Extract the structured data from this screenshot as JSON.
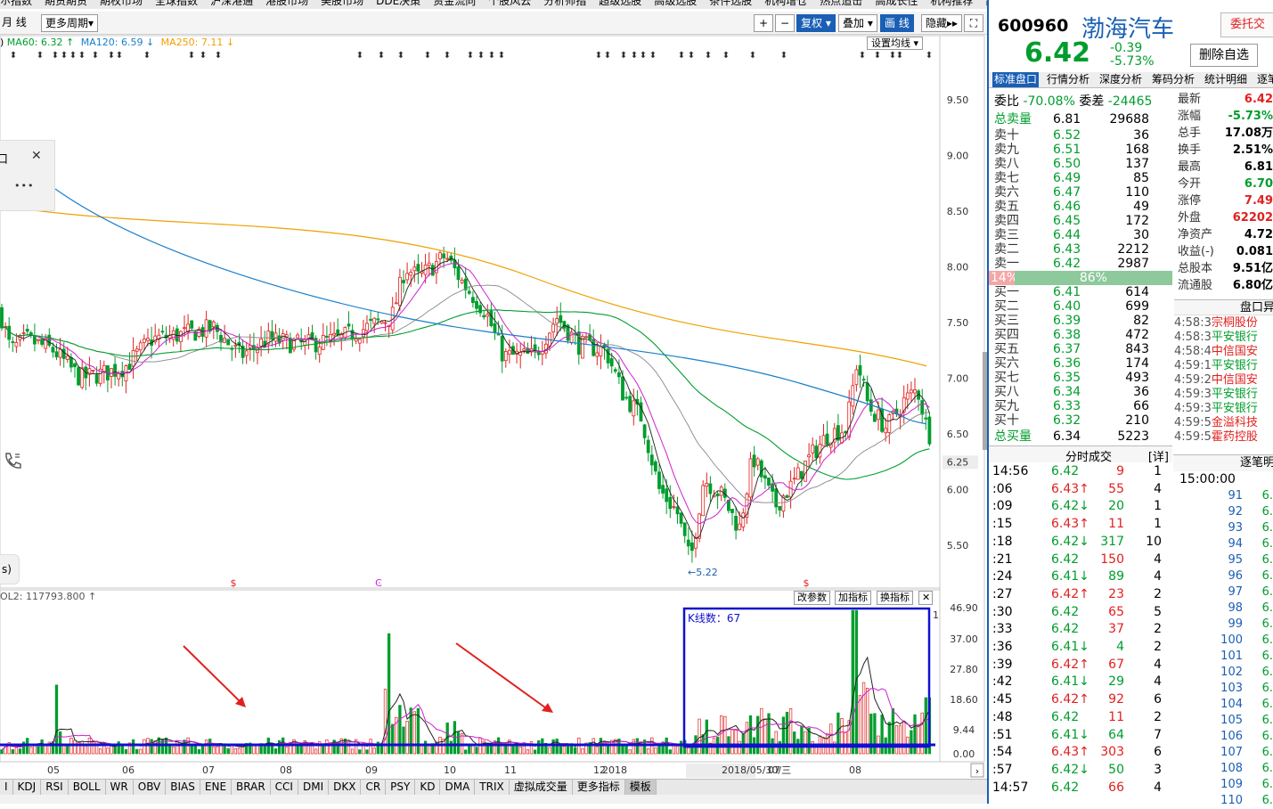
{
  "top_menu": [
    "ホ指数",
    "期货期货",
    "期权市场",
    "全球指数",
    "沪深港通",
    "港股市场",
    "美股市场",
    "DDE决策",
    "资金流向",
    "个股风云",
    "分析师指",
    "超级选股",
    "高级选股",
    "条件选股",
    "机构增仓",
    "热点追击",
    "高成长性",
    "机构推荐",
    "高管增持"
  ],
  "toolbar": {
    "period_partial": "月 线",
    "more_periods": "更多周期",
    "plus": "+",
    "minus": "−",
    "restore": "复权",
    "overlay": "叠加",
    "draw": "画 线",
    "hide": "隐藏",
    "fullscreen": "⛶"
  },
  "ma": {
    "ma60": "MA60: 6.32",
    "ma120": "MA120: 6.59",
    "ma250": "MA250: 7.11",
    "ma60_color": "#009d2d",
    "ma120_color": "#1a7fc9",
    "ma250_color": "#f0a000",
    "prefix": ")"
  },
  "set_ma": "设置均线 ▾",
  "float_panel": {
    "close": "✕",
    "more": "•••",
    "left_char": "口"
  },
  "edge_btn": "s)",
  "price_axis": [
    "9.50",
    "9.00",
    "8.50",
    "8.00",
    "7.50",
    "7.00",
    "6.50",
    "6.25",
    "6.00",
    "5.50"
  ],
  "vol_axis": [
    "46.90",
    "37.00",
    "27.80",
    "18.60",
    "9.44",
    "0.00"
  ],
  "low_price_label": "←5.22",
  "marker_s1": "$",
  "marker_c": "Ͼ",
  "marker_s2": "$",
  "x_labels": [
    "05",
    "06",
    "07",
    "08",
    "09",
    "10",
    "11",
    "12",
    "2018",
    "2018/05/30/三",
    "07",
    "08"
  ],
  "vol_label": "OL2: 117793.800 ↑",
  "vol_buttons": {
    "change": "改参数",
    "add": "加指标",
    "swap": "换指标",
    "close": "✕"
  },
  "kline_box": "K线数：67",
  "vol_edge": "1",
  "bottom_tabs": [
    "I",
    "KDJ",
    "RSI",
    "BOLL",
    "WR",
    "OBV",
    "BIAS",
    "ENE",
    "BRAR",
    "CCI",
    "DMI",
    "DKX",
    "CR",
    "PSY",
    "KD",
    "DMA",
    "TRIX",
    "虚拟成交量",
    "更多指标",
    "模板"
  ],
  "stock": {
    "code": "600960",
    "name": "渤海汽车",
    "price": "6.42",
    "change": "-0.39",
    "pct": "-5.73%",
    "btn_delete": "删除自选",
    "btn_order": "委托交"
  },
  "tabs": [
    "标准盘口",
    "行情分析",
    "深度分析",
    "筹码分析",
    "统计明细",
    "逐笔"
  ],
  "weibi": {
    "label": "委比",
    "value": "-70.08%",
    "diff_label": "委差",
    "diff": "-24465"
  },
  "sell_total": {
    "label": "总卖量",
    "price": "6.81",
    "vol": "29688"
  },
  "sells": [
    {
      "l": "卖十",
      "p": "6.52",
      "v": "36"
    },
    {
      "l": "卖九",
      "p": "6.51",
      "v": "168"
    },
    {
      "l": "卖八",
      "p": "6.50",
      "v": "137"
    },
    {
      "l": "卖七",
      "p": "6.49",
      "v": "85"
    },
    {
      "l": "卖六",
      "p": "6.47",
      "v": "110"
    },
    {
      "l": "卖五",
      "p": "6.46",
      "v": "49"
    },
    {
      "l": "卖四",
      "p": "6.45",
      "v": "172"
    },
    {
      "l": "卖三",
      "p": "6.44",
      "v": "30"
    },
    {
      "l": "卖二",
      "p": "6.43",
      "v": "2212"
    },
    {
      "l": "卖一",
      "p": "6.42",
      "v": "2987"
    }
  ],
  "ratio": {
    "buy": "14%",
    "sell": "86%",
    "buy_frac": 0.14
  },
  "buys": [
    {
      "l": "买一",
      "p": "6.41",
      "v": "614"
    },
    {
      "l": "买二",
      "p": "6.40",
      "v": "699"
    },
    {
      "l": "买三",
      "p": "6.39",
      "v": "82"
    },
    {
      "l": "买四",
      "p": "6.38",
      "v": "472"
    },
    {
      "l": "买五",
      "p": "6.37",
      "v": "843"
    },
    {
      "l": "买六",
      "p": "6.36",
      "v": "174"
    },
    {
      "l": "买七",
      "p": "6.35",
      "v": "493"
    },
    {
      "l": "买八",
      "p": "6.34",
      "v": "36"
    },
    {
      "l": "买九",
      "p": "6.33",
      "v": "66"
    },
    {
      "l": "买十",
      "p": "6.32",
      "v": "210"
    }
  ],
  "buy_total": {
    "label": "总买量",
    "price": "6.34",
    "vol": "5223"
  },
  "stats": [
    {
      "l": "最新",
      "v": "6.42",
      "c": "red"
    },
    {
      "l": "涨幅",
      "v": "-5.73%",
      "c": "grn"
    },
    {
      "l": "总手",
      "v": "17.08万",
      "c": ""
    },
    {
      "l": "换手",
      "v": "2.51%",
      "c": ""
    },
    {
      "l": "最高",
      "v": "6.81",
      "c": ""
    },
    {
      "l": "今开",
      "v": "6.70",
      "c": "grn"
    },
    {
      "l": "涨停",
      "v": "7.49",
      "c": "red"
    },
    {
      "l": "外盘",
      "v": "62202",
      "c": "red"
    },
    {
      "l": "净资产",
      "v": "4.72",
      "c": ""
    },
    {
      "l": "收益(-)",
      "v": "0.081",
      "c": ""
    },
    {
      "l": "总股本",
      "v": "9.51亿",
      "c": ""
    },
    {
      "l": "流通股",
      "v": "6.80亿",
      "c": ""
    }
  ],
  "pankou_title": "盘口异",
  "pankou": [
    {
      "t": "4:58:3",
      "s": "宗桐股份",
      "c": "red"
    },
    {
      "t": "4:58:3",
      "s": "平安银行",
      "c": "grn"
    },
    {
      "t": "4:58:4",
      "s": "中信国安",
      "c": "red"
    },
    {
      "t": "4:59:1",
      "s": "平安银行",
      "c": "grn"
    },
    {
      "t": "4:59:2",
      "s": "中信国安",
      "c": "red"
    },
    {
      "t": "4:59:3",
      "s": "平安银行",
      "c": "grn"
    },
    {
      "t": "4:59:3",
      "s": "平安银行",
      "c": "grn"
    },
    {
      "t": "4:59:5",
      "s": "金溢科技",
      "c": "red"
    },
    {
      "t": "4:59:5",
      "s": "霍药控股",
      "c": "red"
    }
  ],
  "ticks_title": "分时成交",
  "ticks_detail": "[详]",
  "ticks": [
    {
      "t": "14:56",
      "p": "6.42",
      "a": "",
      "v": "9",
      "n": "1"
    },
    {
      "t": ":06",
      "p": "6.43",
      "a": "↑",
      "v": "55",
      "n": "4"
    },
    {
      "t": ":09",
      "p": "6.42",
      "a": "↓",
      "v": "20",
      "n": "1"
    },
    {
      "t": ":15",
      "p": "6.43",
      "a": "↑",
      "v": "11",
      "n": "1"
    },
    {
      "t": ":18",
      "p": "6.42",
      "a": "↓",
      "v": "317",
      "n": "10"
    },
    {
      "t": ":21",
      "p": "6.42",
      "a": "",
      "v": "150",
      "n": "4"
    },
    {
      "t": ":24",
      "p": "6.41",
      "a": "↓",
      "v": "89",
      "n": "4"
    },
    {
      "t": ":27",
      "p": "6.42",
      "a": "↑",
      "v": "23",
      "n": "2"
    },
    {
      "t": ":30",
      "p": "6.42",
      "a": "",
      "v": "65",
      "n": "5"
    },
    {
      "t": ":33",
      "p": "6.42",
      "a": "",
      "v": "37",
      "n": "2"
    },
    {
      "t": ":36",
      "p": "6.41",
      "a": "↓",
      "v": "4",
      "n": "2"
    },
    {
      "t": ":39",
      "p": "6.42",
      "a": "↑",
      "v": "67",
      "n": "4"
    },
    {
      "t": ":42",
      "p": "6.41",
      "a": "↓",
      "v": "29",
      "n": "4"
    },
    {
      "t": ":45",
      "p": "6.42",
      "a": "↑",
      "v": "92",
      "n": "6"
    },
    {
      "t": ":48",
      "p": "6.42",
      "a": "",
      "v": "11",
      "n": "2"
    },
    {
      "t": ":51",
      "p": "6.41",
      "a": "↓",
      "v": "64",
      "n": "7"
    },
    {
      "t": ":54",
      "p": "6.43",
      "a": "↑",
      "v": "303",
      "n": "6"
    },
    {
      "t": ":57",
      "p": "6.42",
      "a": "↓",
      "v": "50",
      "n": "3"
    },
    {
      "t": "14:57",
      "p": "6.42",
      "a": "",
      "v": "66",
      "n": "4"
    }
  ],
  "zhubi_title": "逐笔明",
  "zhubi_time": "15:00:00",
  "zhubi": [
    {
      "n": "91",
      "v": "6."
    },
    {
      "n": "92",
      "v": "6."
    },
    {
      "n": "93",
      "v": "6."
    },
    {
      "n": "94",
      "v": "6."
    },
    {
      "n": "95",
      "v": "6."
    },
    {
      "n": "96",
      "v": "6."
    },
    {
      "n": "97",
      "v": "6."
    },
    {
      "n": "98",
      "v": "6."
    },
    {
      "n": "99",
      "v": "6."
    },
    {
      "n": "100",
      "v": "6."
    },
    {
      "n": "101",
      "v": "6."
    },
    {
      "n": "102",
      "v": "6."
    },
    {
      "n": "103",
      "v": "6."
    },
    {
      "n": "104",
      "v": "6."
    },
    {
      "n": "105",
      "v": "6."
    },
    {
      "n": "106",
      "v": "6."
    },
    {
      "n": "107",
      "v": "6."
    },
    {
      "n": "108",
      "v": "6."
    },
    {
      "n": "109",
      "v": "6."
    },
    {
      "n": "110",
      "v": "6."
    }
  ],
  "colors": {
    "up": "#e0211f",
    "down": "#009d2d",
    "accent": "#1a5fb4"
  }
}
